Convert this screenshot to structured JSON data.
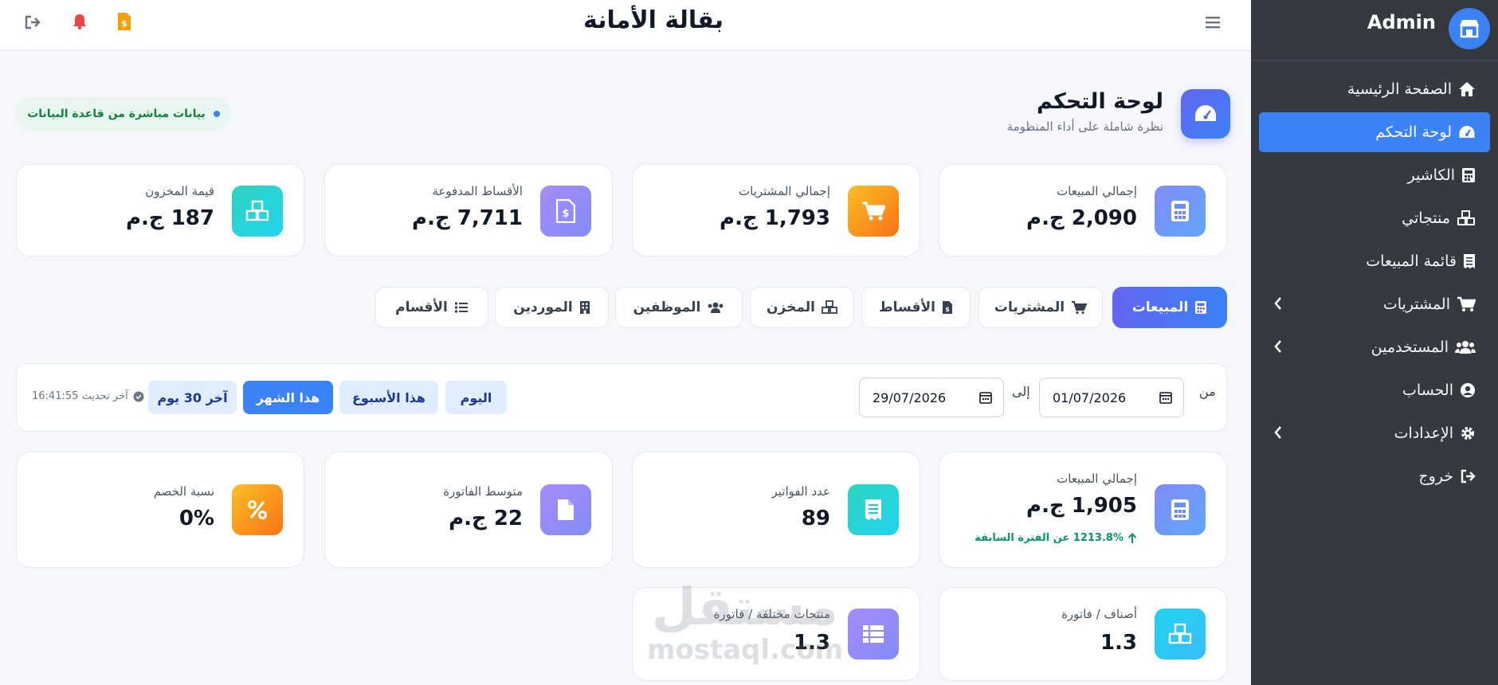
{
  "sidebar": {
    "brand": "Admin",
    "items": [
      {
        "label": "الصفحة الرئيسية",
        "icon": "home-icon"
      },
      {
        "label": "لوحة التحكم",
        "icon": "gauge-icon",
        "active": true
      },
      {
        "label": "الكاشير",
        "icon": "calculator-icon"
      },
      {
        "label": "منتجاتي",
        "icon": "cubes-icon"
      },
      {
        "label": "قائمة المبيعات",
        "icon": "receipt-icon"
      },
      {
        "label": "المشتريات",
        "icon": "cart-icon",
        "expandable": true
      },
      {
        "label": "المستخدمين",
        "icon": "users-icon",
        "expandable": true
      },
      {
        "label": "الحساب",
        "icon": "user-circle-icon"
      },
      {
        "label": "الإعدادات",
        "icon": "gear-icon",
        "expandable": true
      },
      {
        "label": "خروج",
        "icon": "sign-out-icon"
      }
    ]
  },
  "topbar": {
    "title": "بقالة الأمانة",
    "icons": [
      "sign-out-icon",
      "bell-icon",
      "invoice-icon",
      "hamburger-icon"
    ]
  },
  "header": {
    "title": "لوحة التحكم",
    "subtitle": "نظرة شاملة على أداء المنظومة",
    "live_badge": "بيانات مباشرة من قاعدة البيانات"
  },
  "summary_cards": [
    {
      "label": "إجمالي المبيعات",
      "value": "2,090 ج.م",
      "icon": "calculator-icon",
      "color": "#6366f1"
    },
    {
      "label": "إجمالي المشتريات",
      "value": "1,793 ج.م",
      "icon": "cart-icon",
      "color": "#f59e0b"
    },
    {
      "label": "الأقساط المدفوعة",
      "value": "7,711 ج.م",
      "icon": "invoice-dollar-icon",
      "color": "#8b5cf6"
    },
    {
      "label": "قيمة المخزون",
      "value": "187 ج.م",
      "icon": "cubes-icon",
      "color": "#14b8a6"
    }
  ],
  "tabs": [
    {
      "label": "المبيعات",
      "icon": "calculator-icon",
      "active": true
    },
    {
      "label": "المشتريات",
      "icon": "cart-icon"
    },
    {
      "label": "الأقساط",
      "icon": "invoice-dollar-icon"
    },
    {
      "label": "المخزن",
      "icon": "cubes-icon"
    },
    {
      "label": "الموظفين",
      "icon": "users-icon"
    },
    {
      "label": "الموردين",
      "icon": "building-icon"
    },
    {
      "label": "الأقسام",
      "icon": "list-icon"
    }
  ],
  "filter": {
    "from_label": "من",
    "to_label": "إلى",
    "from_date": "01/07/2026",
    "to_date": "29/07/2026",
    "presets": [
      {
        "label": "اليوم"
      },
      {
        "label": "هذا الأسبوع"
      },
      {
        "label": "هذا الشهر",
        "active": true
      },
      {
        "label": "آخر 30 يوم"
      }
    ],
    "last_update": "آخر تحديث 16:41:55"
  },
  "stat_cards": [
    {
      "label": "إجمالي المبيعات",
      "value": "1,905 ج.م",
      "trend": "1213.8% عن الفترة السابقة",
      "icon": "calculator-icon",
      "color": "#6366f1"
    },
    {
      "label": "عدد الفواتير",
      "value": "89",
      "icon": "receipt-icon",
      "color": "#14b8a6"
    },
    {
      "label": "متوسط الفاتورة",
      "value": "22 ج.م",
      "icon": "file-icon",
      "color": "#8b5cf6"
    },
    {
      "label": "نسبة الخصم",
      "value": "0%",
      "icon": "percent-icon",
      "color": "#f59e0b"
    }
  ],
  "extra_cards": [
    {
      "label": "أصناف / فاتورة",
      "value": "1.3",
      "icon": "cubes-icon",
      "color": "#06b6d4"
    },
    {
      "label": "منتجات مختلفة / فاتورة",
      "value": "1.3",
      "icon": "table-icon",
      "color": "#8b5cf6"
    }
  ],
  "watermark": {
    "line1": "مستقل",
    "line2": "mostaql.com"
  }
}
